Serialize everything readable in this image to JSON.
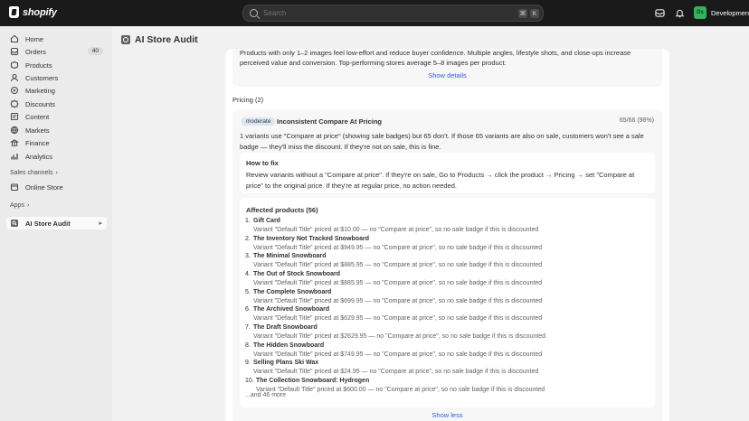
{
  "topbar": {
    "logo_text": "shopify",
    "search_placeholder": "Search",
    "kbd_cmd": "⌘",
    "kbd_key": "K",
    "store_initials": "Ds",
    "store_name": "Development s"
  },
  "sidebar": {
    "items": [
      {
        "label": "Home",
        "icon": "home-icon"
      },
      {
        "label": "Orders",
        "icon": "orders-icon",
        "badge": "40"
      },
      {
        "label": "Products",
        "icon": "products-icon"
      },
      {
        "label": "Customers",
        "icon": "customers-icon"
      },
      {
        "label": "Marketing",
        "icon": "marketing-icon"
      },
      {
        "label": "Discounts",
        "icon": "discounts-icon"
      },
      {
        "label": "Content",
        "icon": "content-icon"
      },
      {
        "label": "Markets",
        "icon": "globe-icon"
      },
      {
        "label": "Finance",
        "icon": "finance-icon"
      },
      {
        "label": "Analytics",
        "icon": "analytics-icon"
      }
    ],
    "sales_channels_label": "Sales channels",
    "online_store_label": "Online Store",
    "apps_label": "Apps",
    "app_item_label": "AI Store Audit"
  },
  "page": {
    "title": "AI Store Audit"
  },
  "top_section": {
    "text": "Products with only 1–2 images feel low-effort and reduce buyer confidence. Multiple angles, lifestyle shots, and close-ups increase perceived value and conversion. Top-performing stores average 5–8 images per product.",
    "show_details": "Show details"
  },
  "pricing": {
    "section_label": "Pricing (2)",
    "issue": {
      "severity": "moderate",
      "title": "Inconsistent Compare At Pricing",
      "score": "65/66 (98%)",
      "description": "1 variants use \"Compare at price\" (showing sale badges) but 65 don't. If those 65 variants are also on sale, customers won't see a sale badge — they'll miss the discount. If they're not on sale, this is fine.",
      "fix_title": "How to fix",
      "fix_text": "Review variants without a \"Compare at price\". If they're on sale, Go to Products → click the product → Pricing → set \"Compare at price\" to the original price. If they're at regular price, no action needed.",
      "affected_title": "Affected products (56)",
      "products": [
        {
          "num": "1.",
          "name": "Gift Card",
          "detail": "Variant \"Default Title\" priced at $10.00 — no \"Compare at price\", so no sale badge if this is discounted"
        },
        {
          "num": "2.",
          "name": "The Inventory Not Tracked Snowboard",
          "detail": "Variant \"Default Title\" priced at $949.95 — no \"Compare at price\", so no sale badge if this is discounted"
        },
        {
          "num": "3.",
          "name": "The Minimal Snowboard",
          "detail": "Variant \"Default Title\" priced at $885.95 — no \"Compare at price\", so no sale badge if this is discounted"
        },
        {
          "num": "4.",
          "name": "The Out of Stock Snowboard",
          "detail": "Variant \"Default Title\" priced at $885.95 — no \"Compare at price\", so no sale badge if this is discounted"
        },
        {
          "num": "5.",
          "name": "The Complete Snowboard",
          "detail": "Variant \"Default Title\" priced at $699.95 — no \"Compare at price\", so no sale badge if this is discounted"
        },
        {
          "num": "6.",
          "name": "The Archived Snowboard",
          "detail": "Variant \"Default Title\" priced at $629.95 — no \"Compare at price\", so no sale badge if this is discounted"
        },
        {
          "num": "7.",
          "name": "The Draft Snowboard",
          "detail": "Variant \"Default Title\" priced at $2629.95 — no \"Compare at price\", so no sale badge if this is discounted"
        },
        {
          "num": "8.",
          "name": "The Hidden Snowboard",
          "detail": "Variant \"Default Title\" priced at $749.95 — no \"Compare at price\", so no sale badge if this is discounted"
        },
        {
          "num": "9.",
          "name": "Selling Plans Ski Wax",
          "detail": "Variant \"Default Title\" priced at $24.95 — no \"Compare at price\", so no sale badge if this is discounted"
        },
        {
          "num": "10.",
          "name": "The Collection Snowboard: Hydrogen",
          "detail": "Variant \"Default Title\" priced at $600.00 — no \"Compare at price\", so no sale badge if this is discounted"
        }
      ],
      "more_text": "...and 46 more",
      "show_less": "Show less"
    }
  },
  "colors": {
    "topbar_bg": "#1a1a1a",
    "sidebar_bg": "#ebebeb",
    "link": "#2a5fd3",
    "store_avatar": "#2fb55a"
  }
}
